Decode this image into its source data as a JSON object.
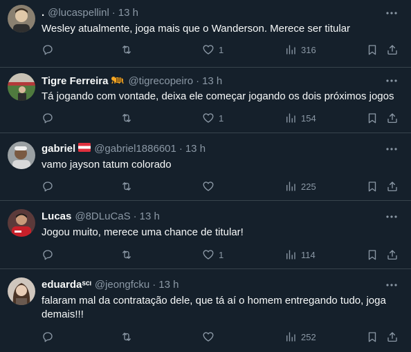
{
  "tweets": [
    {
      "name": ".",
      "handle": "@lucaspellinl",
      "dot": "·",
      "time": "13 h",
      "text": "Wesley atualmente, joga mais que o Wanderson. Merece ser titular",
      "likes": "1",
      "views": "316",
      "badge": ""
    },
    {
      "name": "Tigre Ferreira",
      "handle": "@tigrecopeiro",
      "dot": "·",
      "time": "13 h",
      "text": "Tá jogando com vontade, deixa ele começar jogando os dois próximos jogos",
      "likes": "1",
      "views": "154",
      "badge": "tiger-emoji-icon"
    },
    {
      "name": "gabriel",
      "handle": "@gabriel1886601",
      "dot": "·",
      "time": "13 h",
      "text": "vamo jayson tatum colorado",
      "likes": "",
      "views": "225",
      "badge": "austria-flag-icon"
    },
    {
      "name": "Lucas",
      "handle": "@8DLuCaS",
      "dot": "·",
      "time": "13 h",
      "text": "Jogou muito, merece uma chance de titular!",
      "likes": "1",
      "views": "114",
      "badge": ""
    },
    {
      "name": "eduardaˢᶜᶦ",
      "handle": "@jeongfcku",
      "dot": "·",
      "time": "13 h",
      "text": "falaram mal da contratação dele, que tá aí o homem entregando tudo, joga demais!!!",
      "likes": "",
      "views": "252",
      "badge": ""
    }
  ],
  "colors": {
    "background": "#15202b",
    "divider": "#38444d",
    "secondary_text": "#8b98a5",
    "primary_text": "#f7f9f9"
  }
}
